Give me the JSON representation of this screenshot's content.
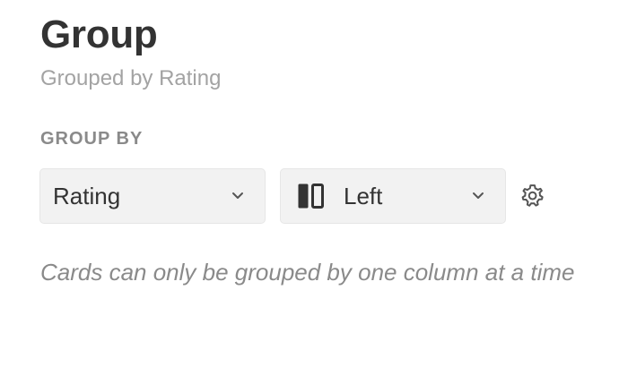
{
  "panel": {
    "title": "Group",
    "subtitle": "Grouped by Rating"
  },
  "group_by": {
    "label": "GROUP BY",
    "column_select": {
      "value": "Rating",
      "icon": "chevron-down-icon"
    },
    "position_select": {
      "value": "Left",
      "icon": "layout-left-icon",
      "chevron_icon": "chevron-down-icon"
    },
    "settings_icon": "gear-icon",
    "help_text": "Cards can only be grouped by one column at a time"
  }
}
